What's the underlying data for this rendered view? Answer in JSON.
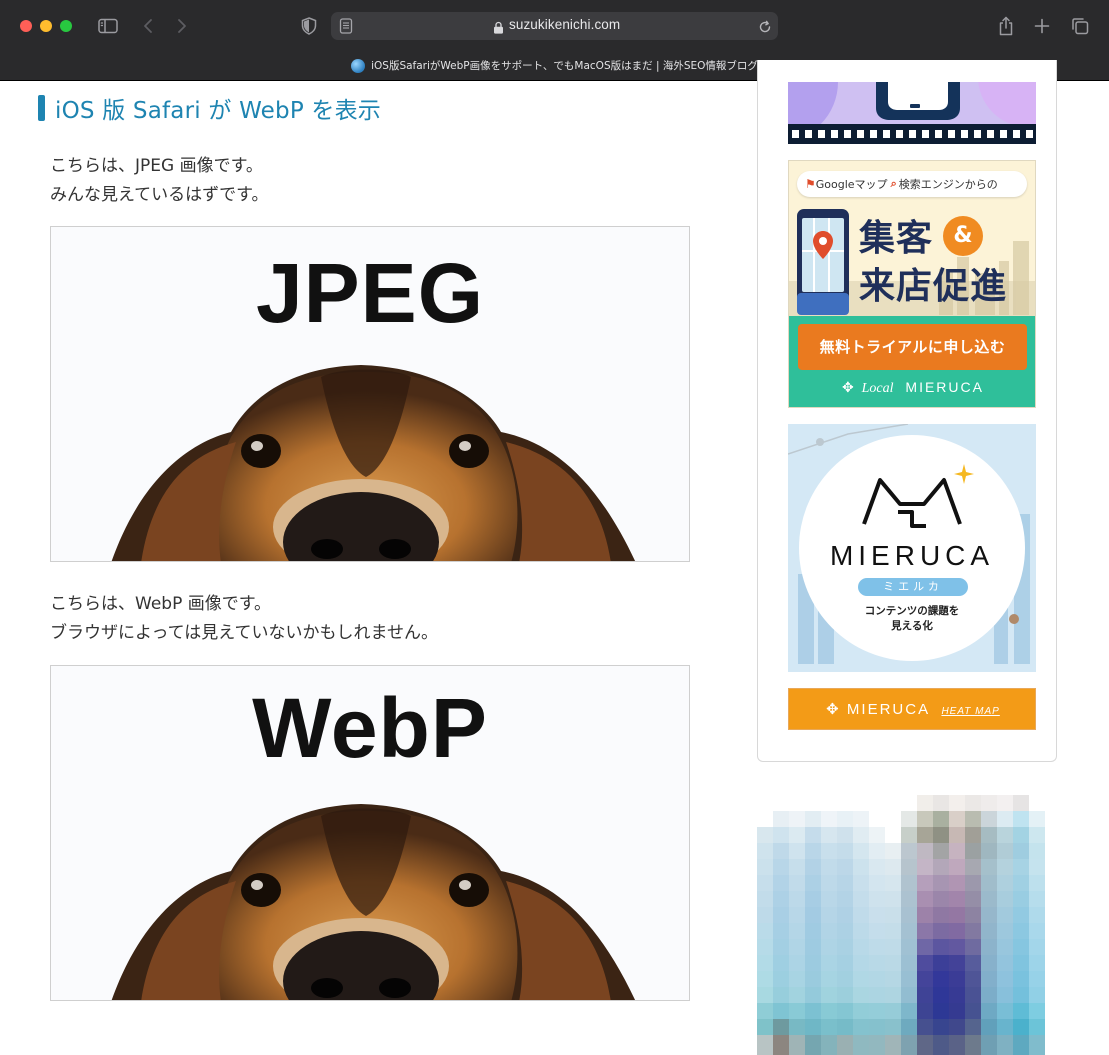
{
  "browser": {
    "url": "suzukikenichi.com",
    "tab_title": "iOS版SafariがWebP画像をサポート、でもMacOS版はまだ | 海外SEO情報ブログ"
  },
  "article": {
    "heading": "iOS 版 Safari が WebP を表示",
    "para1_line1": "こちらは、JPEG 画像です。",
    "para1_line2": "みんな見えているはずです。",
    "image1_label": "JPEG",
    "para2_line1": "こちらは、WebP 画像です。",
    "para2_line2": "ブラウザによっては見えていないかもしれません。",
    "image2_label": "WebP"
  },
  "sidebar": {
    "local_ad": {
      "pill_google": "Googleマップ",
      "pill_search": "検索エンジンからの",
      "headline1": "集客",
      "amp": "&",
      "headline2": "来店促進",
      "cta": "無料トライアルに申し込む",
      "logo_local": "Local",
      "logo_brand": "MIERUCA"
    },
    "mieruca_ad": {
      "brand": "MIERUCA",
      "kana": "ミエルカ",
      "tagline1": "コンテンツの課題を",
      "tagline2": "見える化"
    },
    "heatmap_ad": {
      "brand": "MIERUCA",
      "tag": "HEAT MAP"
    }
  },
  "colors": {
    "accent": "#1e84b1",
    "chrome_bg": "#2a2a2c",
    "cta_orange": "#ea7a1f",
    "heatmap_orange": "#f39b17",
    "local_green": "#2fbf9a"
  }
}
